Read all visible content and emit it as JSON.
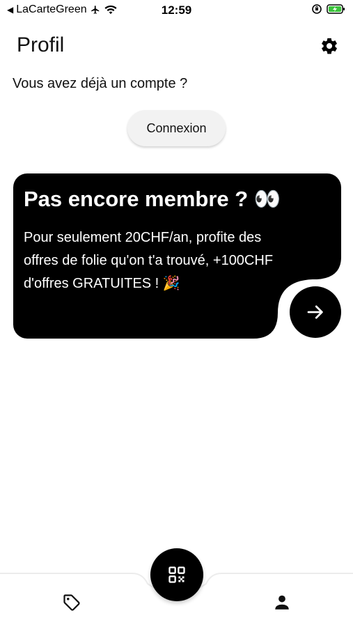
{
  "status_bar": {
    "back_arrow": "◀",
    "carrier": "LaCarteGreen",
    "time": "12:59",
    "icons": [
      "airplane-icon",
      "wifi-icon",
      "orientation-lock-icon",
      "battery-charging-icon"
    ]
  },
  "header": {
    "title": "Profil",
    "settings_icon": "gear-icon"
  },
  "account": {
    "question": "Vous avez déjà un compte ?",
    "login_label": "Connexion"
  },
  "promo": {
    "title": "Pas encore membre ? 👀",
    "body": "Pour seulement 20CHF/an, profite des offres de folie qu'on t'a trouvé, +100CHF d'offres GRATUITES ! 🎉",
    "next_icon": "arrow-right-icon"
  },
  "bottom_nav": {
    "items": [
      {
        "icon": "tag-icon"
      },
      {
        "icon": "qr-code-icon"
      },
      {
        "icon": "user-icon"
      }
    ]
  },
  "colors": {
    "background": "#ffffff",
    "card": "#000000",
    "button": "#f2f2f2",
    "battery": "#3cc43c"
  }
}
